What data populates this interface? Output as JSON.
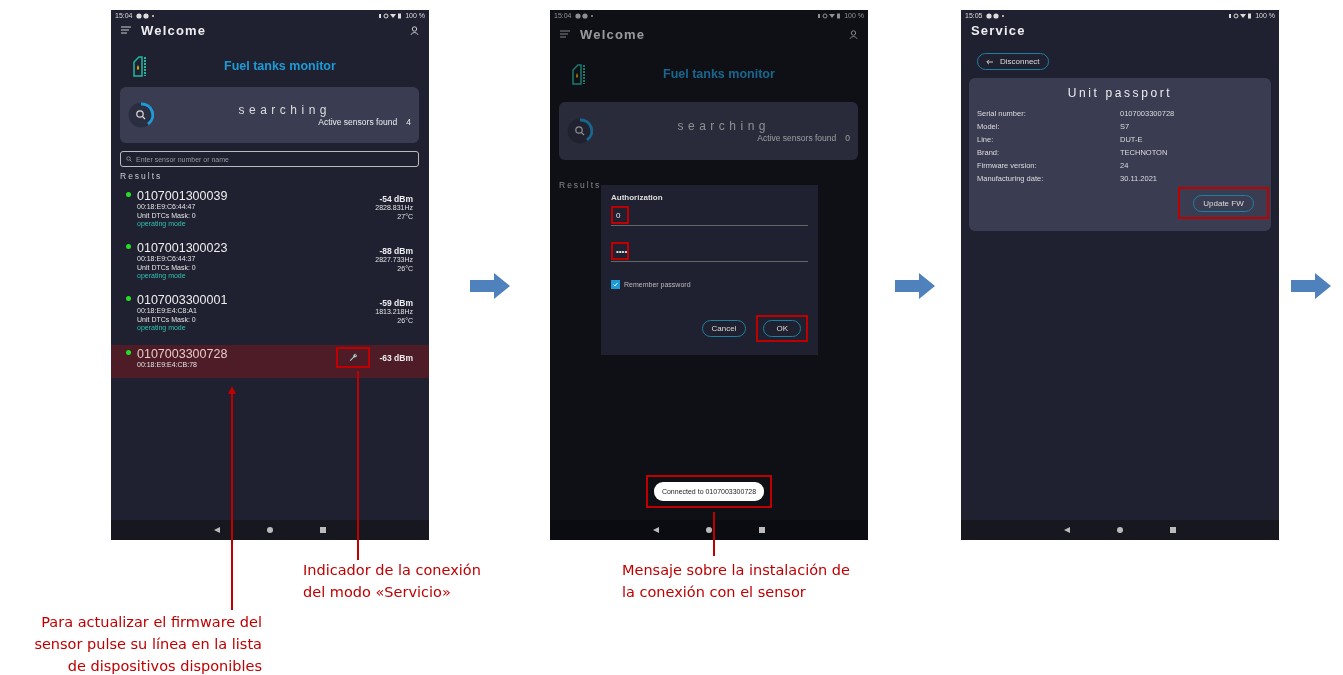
{
  "screens": [
    {
      "kind": "scan",
      "status_bar": {
        "time": "15:04",
        "battery": "100 %"
      },
      "title": "Welcome",
      "app_name": "Fuel tanks monitor",
      "search_status": "searching",
      "found_label": "Active sensors found",
      "found_count": "4",
      "search_field": {
        "placeholder": "Enter sensor number or name"
      },
      "results_label": "Results",
      "sensors": [
        {
          "id": "0107001300039",
          "mac": "00:18:E9:C6:44:47",
          "mask": "Unit DTCs Mask: 0",
          "mode": "operating mode",
          "rssi": "-54 dBm",
          "frequency": "2828.831Hz",
          "temperature": "27°C",
          "selected": false,
          "service": false
        },
        {
          "id": "0107001300023",
          "mac": "00:18:E9:C6:44:37",
          "mask": "Unit DTCs Mask: 0",
          "mode": "operating mode",
          "rssi": "-88 dBm",
          "frequency": "2827.733Hz",
          "temperature": "26°C",
          "selected": false,
          "service": false
        },
        {
          "id": "0107003300001",
          "mac": "00:18:E9:E4:C8:A1",
          "mask": "Unit DTCs Mask: 0",
          "mode": "operating mode",
          "rssi": "-59 dBm",
          "frequency": "1813.218Hz",
          "temperature": "26°C",
          "selected": false,
          "service": false
        },
        {
          "id": "0107003300728",
          "mac": "00:18:E9:E4:CB:78",
          "rssi": "-63 dBm",
          "selected": true,
          "service": true,
          "highlighted": true
        }
      ]
    },
    {
      "kind": "auth",
      "status_bar": {
        "time": "15:04",
        "battery": "100 %"
      },
      "title": "Welcome",
      "app_name": "Fuel tanks monitor",
      "search_status": "searching",
      "found_label": "Active sensors found",
      "found_count": "0",
      "results_label": "Results",
      "dialog": {
        "title": "Authorization",
        "login": {
          "value": "0",
          "highlighted": true
        },
        "password": {
          "value": "••••",
          "highlighted": true
        },
        "remember": {
          "label": "Remember password",
          "checked": true
        },
        "buttons": [
          {
            "label": "Cancel",
            "highlighted": false
          },
          {
            "label": "OK",
            "highlighted": true
          }
        ]
      },
      "toast": {
        "text": "Connected to 0107003300728",
        "highlighted": true
      }
    },
    {
      "kind": "service",
      "status_bar": {
        "time": "15:05",
        "battery": "100 %"
      },
      "title": "Service",
      "back_button": "Disconnect",
      "card": {
        "title": "Unit passport",
        "fields": [
          {
            "label": "Serial number:",
            "value": "0107003300728"
          },
          {
            "label": "Model:",
            "value": "S7"
          },
          {
            "label": "Line:",
            "value": "DUT-E"
          },
          {
            "label": "Brand:",
            "value": "TECHNOTON"
          },
          {
            "label": "Firmware version:",
            "value": "24"
          },
          {
            "label": "Manufacturing date:",
            "value": "30.11.2021"
          }
        ],
        "button": {
          "label": "Update FW",
          "highlighted": true
        }
      }
    }
  ],
  "callouts": [
    {
      "text": "Para actualizar el firmware del sensor pulse su línea en la lista de dispositivos disponibles"
    },
    {
      "text": "Indicador de la conexión del modo «Servicio»"
    },
    {
      "text": "Mensaje sobre la instalación de la conexión con el sensor"
    }
  ]
}
